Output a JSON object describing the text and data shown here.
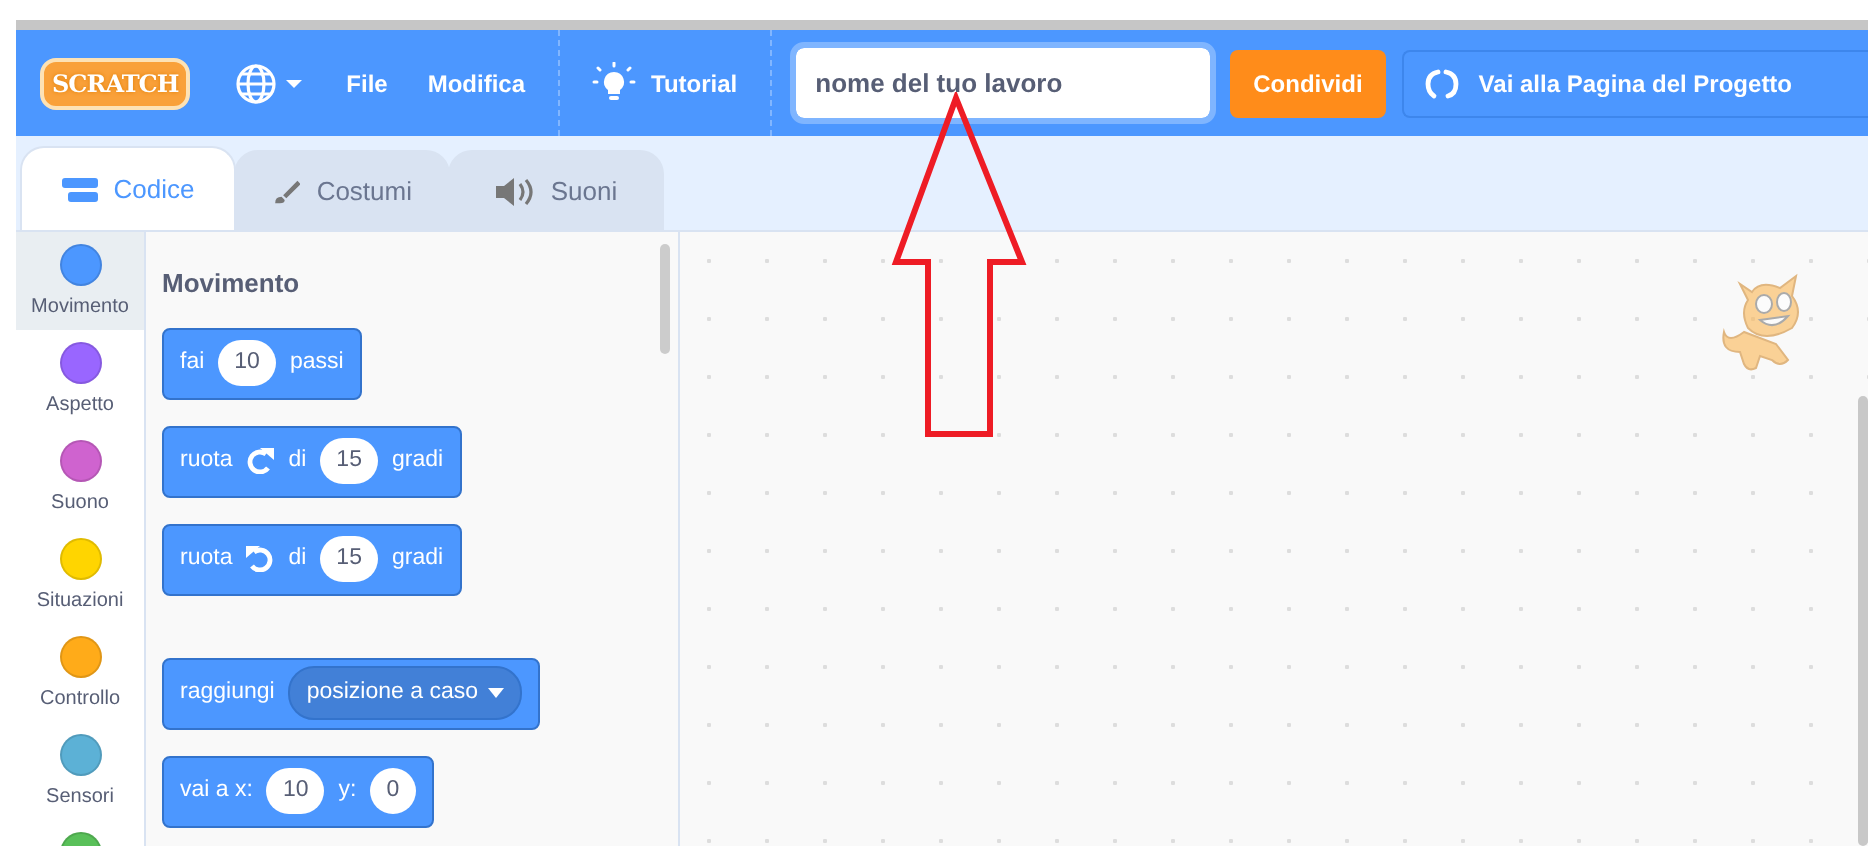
{
  "menubar": {
    "logo": "SCRATCH",
    "menu_items": [
      "File",
      "Modifica"
    ],
    "tutorial": "Tutorial",
    "project_title": {
      "value": "nome del tuo lavoro"
    },
    "share_button": "Condividi",
    "project_page_button": "Vai alla Pagina del Progetto"
  },
  "tabs": [
    {
      "label": "Codice",
      "kind": "code",
      "selected": true
    },
    {
      "label": "Costumi",
      "kind": "costumes",
      "selected": false
    },
    {
      "label": "Suoni",
      "kind": "sounds",
      "selected": false
    }
  ],
  "categories": [
    {
      "label": "Movimento",
      "color": "#4c97ff",
      "selected": true
    },
    {
      "label": "Aspetto",
      "color": "#9966ff",
      "selected": false
    },
    {
      "label": "Suono",
      "color": "#cf63cf",
      "selected": false
    },
    {
      "label": "Situazioni",
      "color": "#ffd500",
      "selected": false
    },
    {
      "label": "Controllo",
      "color": "#ffab19",
      "selected": false
    },
    {
      "label": "Sensori",
      "color": "#5cb1d6",
      "selected": false
    },
    {
      "color": "#59c059",
      "selected": false
    }
  ],
  "palette": {
    "heading": "Movimento",
    "blocks": [
      {
        "parts": [
          {
            "kind": "text",
            "text": "fai"
          },
          {
            "kind": "number",
            "text": "10"
          },
          {
            "kind": "text",
            "text": "passi"
          }
        ]
      },
      {
        "parts": [
          {
            "kind": "text",
            "text": "ruota"
          },
          {
            "kind": "turn_right"
          },
          {
            "kind": "text",
            "text": "di"
          },
          {
            "kind": "number",
            "text": "15"
          },
          {
            "kind": "text",
            "text": "gradi"
          }
        ]
      },
      {
        "parts": [
          {
            "kind": "text",
            "text": "ruota"
          },
          {
            "kind": "turn_left"
          },
          {
            "kind": "text",
            "text": "di"
          },
          {
            "kind": "number",
            "text": "15"
          },
          {
            "kind": "text",
            "text": "gradi"
          }
        ]
      },
      {
        "parts": [
          {
            "kind": "text",
            "text": "raggiungi"
          },
          {
            "kind": "dropdown",
            "text": "posizione a caso"
          }
        ]
      },
      {
        "parts": [
          {
            "kind": "text",
            "text": "vai a x:"
          },
          {
            "kind": "number",
            "text": "10"
          },
          {
            "kind": "text",
            "text": "y:"
          },
          {
            "kind": "number",
            "text": "0"
          }
        ]
      }
    ]
  }
}
